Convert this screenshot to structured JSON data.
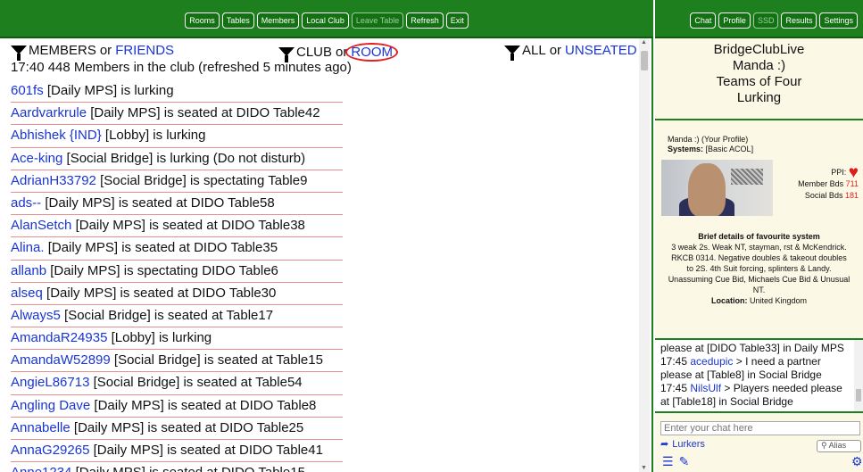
{
  "toolbar": {
    "left_buttons": [
      "Rooms",
      "Tables",
      "Members",
      "Local Club",
      "Leave Table",
      "Refresh",
      "Exit"
    ],
    "right_buttons": [
      "Chat",
      "Profile",
      "SSD",
      "Results",
      "Settings"
    ]
  },
  "filters": {
    "members_label": "MEMBERS",
    "members_or": "or",
    "friends_label": "FRIENDS",
    "club_label": "CLUB",
    "club_or": "or",
    "room_label": "ROOM",
    "all_label": "ALL",
    "all_or": "or",
    "unseated_label": "UNSEATED"
  },
  "status_line": "17:40 448 Members in the club (refreshed 5 minutes ago)",
  "members": [
    {
      "name": "601fs",
      "detail": "[Daily MPS] is lurking"
    },
    {
      "name": "Aardvarkrule",
      "detail": "[Daily MPS] is seated at DIDO Table42"
    },
    {
      "name": "Abhishek {IND}",
      "detail": "[Lobby] is lurking"
    },
    {
      "name": "Ace-king",
      "detail": "[Social Bridge] is lurking (Do not disturb)"
    },
    {
      "name": "AdrianH33792",
      "detail": "[Social Bridge] is spectating Table9"
    },
    {
      "name": "ads--",
      "detail": "[Daily MPS] is seated at DIDO Table58"
    },
    {
      "name": "AlanSetch",
      "detail": "[Daily MPS] is seated at DIDO Table38"
    },
    {
      "name": "Alina.",
      "detail": "[Daily MPS] is seated at DIDO Table35"
    },
    {
      "name": "allanb",
      "detail": "[Daily MPS] is spectating DIDO Table6"
    },
    {
      "name": "alseq",
      "detail": "[Daily MPS] is seated at DIDO Table30"
    },
    {
      "name": "Always5",
      "detail": "[Social Bridge] is seated at Table17"
    },
    {
      "name": "AmandaR24935",
      "detail": "[Lobby] is lurking"
    },
    {
      "name": "AmandaW52899",
      "detail": "[Social Bridge] is seated at Table15"
    },
    {
      "name": "AngieL86713",
      "detail": "[Social Bridge] is seated at Table54"
    },
    {
      "name": "Angling Dave",
      "detail": "[Daily MPS] is seated at DIDO Table8"
    },
    {
      "name": "Annabelle",
      "detail": "[Daily MPS] is seated at DIDO Table25"
    },
    {
      "name": "AnnaG29265",
      "detail": "[Daily MPS] is seated at DIDO Table41"
    },
    {
      "name": "Anne1234",
      "detail": "[Daily MPS] is seated at DIDO Table15"
    }
  ],
  "info_panel": {
    "line1": "BridgeClubLive",
    "line2": "Manda :)",
    "line3": "Teams of Four",
    "line4": "Lurking"
  },
  "profile": {
    "title": "Manda :) (Your Profile)",
    "systems_label": "Systems:",
    "systems_value": "[Basic ACOL]",
    "ppi_label": "PPI:",
    "member_bds_label": "Member Bds",
    "member_bds_value": "711",
    "social_bds_label": "Social Bds",
    "social_bds_value": "181",
    "fav_title": "Brief details of favourite system",
    "fav_text": "3 weak 2s. Weak NT, stayman, rst & McKendrick. RKCB 0314. Negative doubles & takeout doubles to 2S. 4th Suit forcing, splinters & Landy. Unassuming Cue Bid, Michaels Cue Bid & Unusual NT.",
    "location_label": "Location:",
    "location_value": "United Kingdom",
    "heart_color": "#e01b1b"
  },
  "chat": {
    "partial_line": "please at [DIDO Table33] in Daily MPS",
    "msg1_time": "17:45",
    "msg1_user": "acedupic",
    "msg1_text": "> I need a partner please at [Table8] in Social Bridge",
    "msg2_time": "17:45",
    "msg2_user": "NilsUlf",
    "msg2_text": "> Players needed please at [Table18] in Social Bridge",
    "input_placeholder": "Enter your chat here",
    "lurkers_label": "Lurkers",
    "alias_label": "Alias"
  },
  "colors": {
    "green": "#1e7f1e",
    "link_blue": "#1a35d6",
    "row_divider": "#e98f8f",
    "panel_bg": "#fcf8e6"
  }
}
